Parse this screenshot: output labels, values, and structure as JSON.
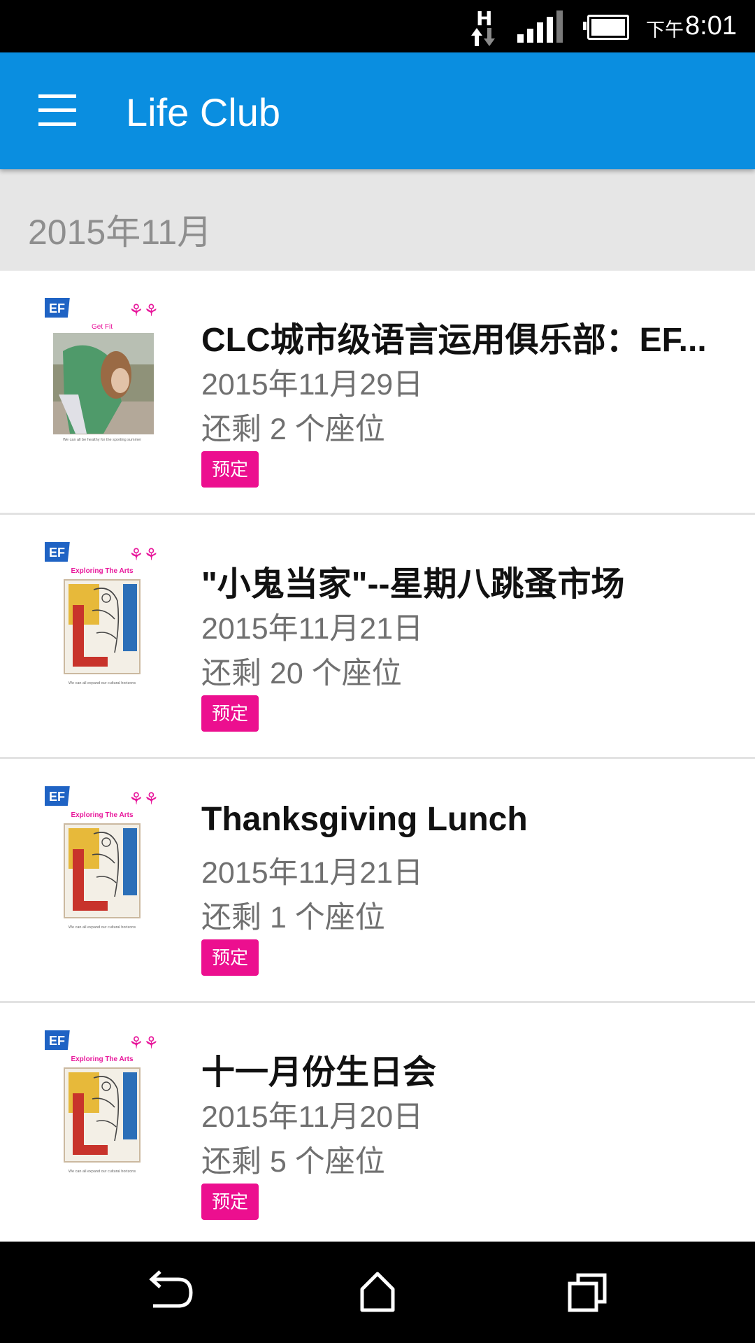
{
  "status_bar": {
    "clock_prefix": "下午",
    "time": "8:01",
    "network_type": "H",
    "icons": [
      "network-h-icon",
      "signal-icon",
      "battery-icon"
    ]
  },
  "app_bar": {
    "title": "Life Club",
    "menu_icon": "hamburger-menu-icon"
  },
  "month_header": {
    "label": "2015年11月"
  },
  "events": [
    {
      "title": "CLC城市级语言运用俱乐部：EF...",
      "date": "2015年11月29日",
      "seats": "还剩 2 个座位",
      "book_label": "预定",
      "thumb_logo": "EF",
      "thumb_heading": "Get Fit",
      "thumb_caption": "We can all be healthy for the sporting summer"
    },
    {
      "title": "\"小鬼当家\"--星期八跳蚤市场",
      "date": "2015年11月21日",
      "seats": "还剩 20 个座位",
      "book_label": "预定",
      "thumb_logo": "EF",
      "thumb_heading": "Exploring The Arts",
      "thumb_caption": "We can all expand our cultural horizons"
    },
    {
      "title": "Thanksgiving Lunch",
      "date": "2015年11月21日",
      "seats": "还剩 1 个座位",
      "book_label": "预定",
      "thumb_logo": "EF",
      "thumb_heading": "Exploring The Arts",
      "thumb_caption": "We can all expand our cultural horizons"
    },
    {
      "title": "十一月份生日会",
      "date": "2015年11月20日",
      "seats": "还剩 5 个座位",
      "book_label": "预定",
      "thumb_logo": "EF",
      "thumb_heading": "Exploring The Arts",
      "thumb_caption": "We can all expand our cultural horizons"
    }
  ],
  "nav_bar": {
    "icons": [
      "back-icon",
      "home-icon",
      "recent-apps-icon"
    ]
  },
  "colors": {
    "primary": "#0a8ee0",
    "accent": "#ec0f8f",
    "header_bg": "#e6e6e6"
  }
}
